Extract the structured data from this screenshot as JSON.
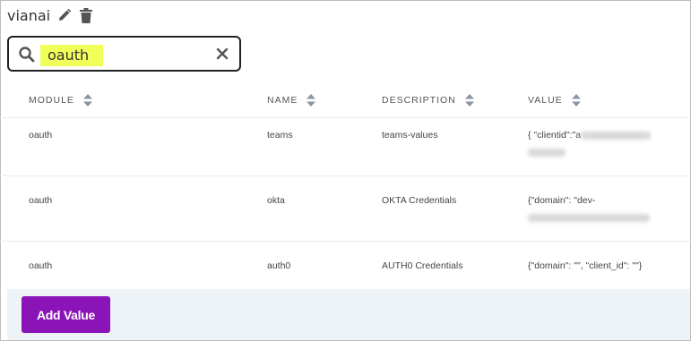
{
  "header": {
    "title": "vianai"
  },
  "search": {
    "query": "oauth"
  },
  "table": {
    "columns": [
      "MODULE",
      "NAME",
      "DESCRIPTION",
      "VALUE"
    ],
    "rows": [
      {
        "module": "oauth",
        "name": "teams",
        "description": "teams-values",
        "value_line1": "{ \"clientid\":\"a",
        "value_line2": ""
      },
      {
        "module": "oauth",
        "name": "okta",
        "description": "OKTA Credentials",
        "value_line1": "{\"domain\": \"dev-",
        "value_line2": ""
      },
      {
        "module": "oauth",
        "name": "auth0",
        "description": "AUTH0 Credentials",
        "value_line1": "{\"domain\": \"\", \"client_id\": \"\"}",
        "value_line2": ""
      }
    ]
  },
  "footer": {
    "add_button_label": "Add Value"
  },
  "colors": {
    "accent": "#8a14b8",
    "highlight": "#f1ff59",
    "footer_bg": "#eef3f8"
  }
}
